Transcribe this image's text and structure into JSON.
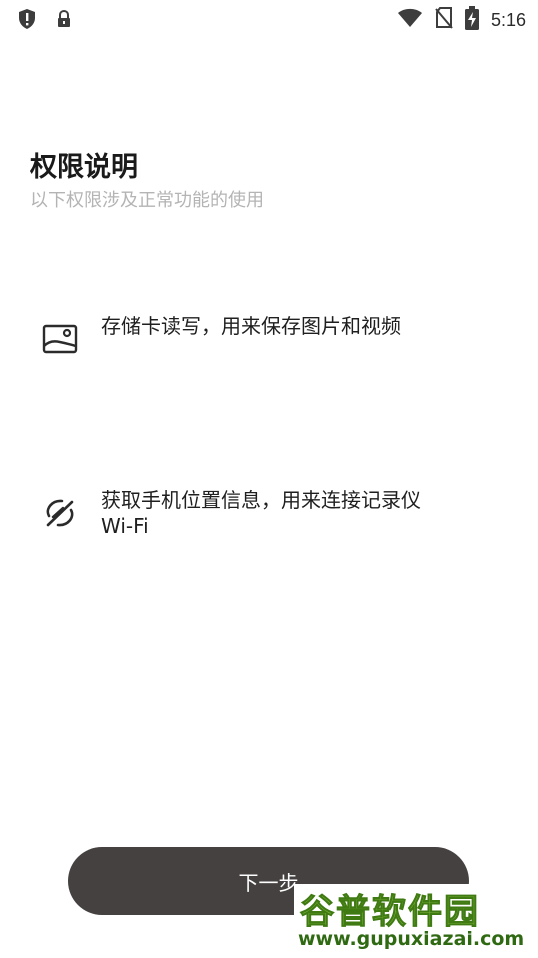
{
  "status_bar": {
    "time": "5:16",
    "left_icons": [
      "shield-alert-icon",
      "lock-icon"
    ],
    "right_icons": [
      "wifi-icon",
      "no-sim-icon",
      "battery-charging-icon"
    ]
  },
  "header": {
    "title": "权限说明",
    "subtitle": "以下权限涉及正常功能的使用"
  },
  "permissions": [
    {
      "icon": "image-icon",
      "text": "存储卡读写，用来保存图片和视频"
    },
    {
      "icon": "location-off-icon",
      "text": "获取手机位置信息，用来连接记录仪Wi-Fi"
    }
  ],
  "footer": {
    "next_label": "下一步"
  },
  "watermark": {
    "title": "谷普软件园",
    "url": "www.gupuxiazai.com"
  }
}
